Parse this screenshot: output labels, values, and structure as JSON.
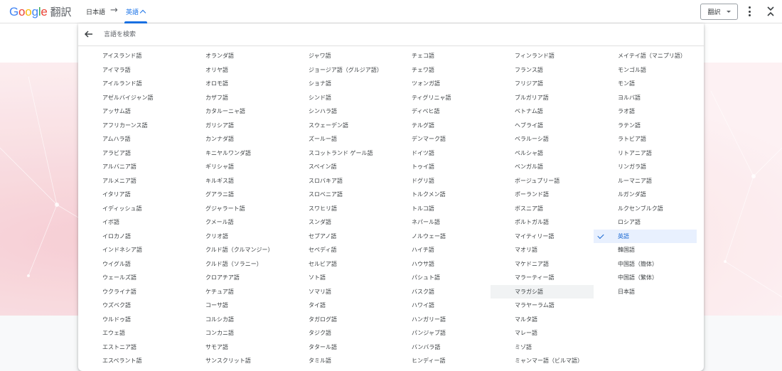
{
  "header": {
    "logo_letters": [
      "G",
      "o",
      "o",
      "g",
      "l",
      "e"
    ],
    "product": "翻訳",
    "source_lang": "日本語",
    "arrow": "→",
    "target_lang": "英語",
    "translate_button": "翻訳"
  },
  "picker": {
    "search_placeholder": "言語を検索",
    "selected": "英語",
    "hovered": "マラガシ語",
    "columns": [
      [
        "アイスランド語",
        "アイマラ語",
        "アイルランド語",
        "アゼルバイジャン語",
        "アッサム語",
        "アフリカーンス語",
        "アムハラ語",
        "アラビア語",
        "アルバニア語",
        "アルメニア語",
        "イタリア語",
        "イディッシュ語",
        "イボ語",
        "イロカノ語",
        "インドネシア語",
        "ウイグル語",
        "ウェールズ語",
        "ウクライナ語",
        "ウズベク語",
        "ウルドゥ語",
        "エウェ語",
        "エストニア語",
        "エスペラント語"
      ],
      [
        "オランダ語",
        "オリヤ語",
        "オロモ語",
        "カザフ語",
        "カタルーニャ語",
        "ガリシア語",
        "カンナダ語",
        "キニヤルワンダ語",
        "ギリシャ語",
        "キルギス語",
        "グアラニ語",
        "グジャラート語",
        "クメール語",
        "クリオ語",
        "クルド語（クルマンジー）",
        "クルド語（ソラニー）",
        "クロアチア語",
        "ケチュア語",
        "コーサ語",
        "コルシカ語",
        "コンカニ語",
        "サモア語",
        "サンスクリット語"
      ],
      [
        "ジャワ語",
        "ジョージア語（グルジア語）",
        "ショナ語",
        "シンド語",
        "シンハラ語",
        "スウェーデン語",
        "ズールー語",
        "スコットランド ゲール語",
        "スペイン語",
        "スロバキア語",
        "スロベニア語",
        "スワヒリ語",
        "スンダ語",
        "セブアノ語",
        "セペディ語",
        "セルビア語",
        "ソト語",
        "ソマリ語",
        "タイ語",
        "タガログ語",
        "タジク語",
        "タタール語",
        "タミル語"
      ],
      [
        "チェコ語",
        "チェワ語",
        "ツォンガ語",
        "ティグリニャ語",
        "ディベヒ語",
        "テルグ語",
        "デンマーク語",
        "ドイツ語",
        "トゥイ語",
        "ドグリ語",
        "トルクメン語",
        "トルコ語",
        "ネパール語",
        "ノルウェー語",
        "ハイチ語",
        "ハウサ語",
        "パシュト語",
        "バスク語",
        "ハワイ語",
        "ハンガリー語",
        "パンジャブ語",
        "バンバラ語",
        "ヒンディー語"
      ],
      [
        "フィンランド語",
        "フランス語",
        "フリジア語",
        "ブルガリア語",
        "ベトナム語",
        "ヘブライ語",
        "ベラルーシ語",
        "ペルシャ語",
        "ベンガル語",
        "ボージュプリー語",
        "ポーランド語",
        "ボスニア語",
        "ポルトガル語",
        "マイティリー語",
        "マオリ語",
        "マケドニア語",
        "マラーティー語",
        "マラガシ語",
        "マラヤーラム語",
        "マルタ語",
        "マレー語",
        "ミゾ語",
        "ミャンマー語（ビルマ語）"
      ],
      [
        "メイテイ語（マニプリ語）",
        "モンゴル語",
        "モン語",
        "ヨルバ語",
        "ラオ語",
        "ラテン語",
        "ラトビア語",
        "リトアニア語",
        "リンガラ語",
        "ルーマニア語",
        "ルガンダ語",
        "ルクセンブルク語",
        "ロシア語",
        "英語",
        "韓国語",
        "中国語（簡体）",
        "中国語（繁体）",
        "日本語"
      ]
    ]
  },
  "colors": {
    "accent": "#1a73e8",
    "selected_bg": "#e8f0fe",
    "hover_bg": "#f1f3f4"
  },
  "icons": {
    "back": "arrow-left-icon",
    "check": "check-icon",
    "more": "more-vert-icon",
    "collapse": "collapse-icon",
    "caret": "chevron-up-icon",
    "dropdown": "dropdown-triangle-icon"
  }
}
